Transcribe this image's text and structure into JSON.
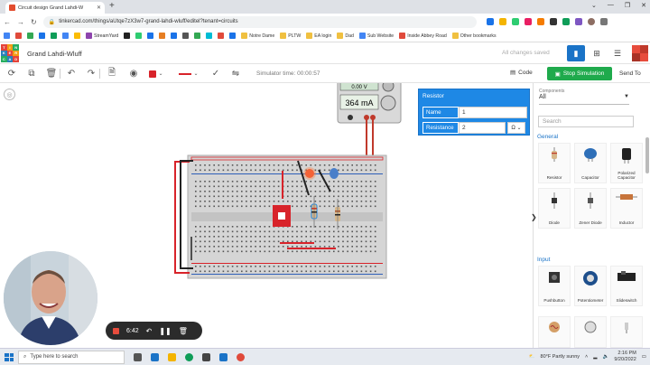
{
  "browser": {
    "tab_title": "Circuit design Grand Lahdi-W",
    "url": "tinkercad.com/things/aUtqe7zX3w7-grand-lahdi-wluff/editel?tenant=circuits",
    "bookmarks": [
      {
        "label": "",
        "color": "#4285f4"
      },
      {
        "label": "",
        "color": "#e04a3b"
      },
      {
        "label": "",
        "color": "#34a853"
      },
      {
        "label": "",
        "color": "#1a73e8"
      },
      {
        "label": "",
        "color": "#0f9d58"
      },
      {
        "label": "",
        "color": "#4285f4"
      },
      {
        "label": "",
        "color": "#fbbc05"
      },
      {
        "label": "StreamYard",
        "color": "#8e44ad"
      },
      {
        "label": "",
        "color": "#222222"
      },
      {
        "label": "",
        "color": "#2ecc71"
      },
      {
        "label": "",
        "color": "#1a73e8"
      },
      {
        "label": "",
        "color": "#e67e22"
      },
      {
        "label": "",
        "color": "#1a73e8"
      },
      {
        "label": "",
        "color": "#555555"
      },
      {
        "label": "",
        "color": "#34a853"
      },
      {
        "label": "",
        "color": "#00bcd4"
      },
      {
        "label": "",
        "color": "#e04a3b"
      },
      {
        "label": "",
        "color": "#1a73e8"
      },
      {
        "label": "Notre Dame",
        "color": "#f0c040"
      },
      {
        "label": "PLTW",
        "color": "#f0c040"
      },
      {
        "label": "EA login",
        "color": "#f0c040"
      },
      {
        "label": "Dad",
        "color": "#f0c040"
      },
      {
        "label": "Sub Website",
        "color": "#4285f4"
      },
      {
        "label": "Inside Abbey Road",
        "color": "#e04a3b"
      },
      {
        "label": "Other bookmarks",
        "color": "#f0c040"
      }
    ]
  },
  "header": {
    "design_title": "Grand Lahdi-Wluff",
    "saved_status": "All changes saved",
    "logo_letters": [
      "TIN",
      "KER",
      "CAD"
    ]
  },
  "toolbar": {
    "sim_time": "Simulator time: 00:00:57",
    "code_label": "Code",
    "stop_label": "Stop Simulation",
    "send_label": "Send To"
  },
  "multimeter": {
    "top_value": "0.00 V",
    "reading": "364 mA"
  },
  "inspector": {
    "title": "Resistor",
    "name_label": "Name",
    "name_value": "1",
    "resistance_label": "Resistance",
    "resistance_value": "2",
    "unit": "Ω"
  },
  "panel": {
    "dropdown_label": "Components",
    "dropdown_value": "All",
    "search_placeholder": "Search",
    "section_general": "General",
    "section_input": "Input",
    "general_items": [
      "Resistor",
      "Capacitor",
      "Polarized Capacitor",
      "Diode",
      "Zener Diode",
      "Inductor"
    ],
    "input_items": [
      "Pushbutton",
      "Potentiometer",
      "Slideswitch"
    ]
  },
  "recorder": {
    "time": "6:42"
  },
  "taskbar": {
    "search_placeholder": "Type here to search",
    "weather": "80°F  Partly sunny",
    "time": "2:16 PM",
    "date": "9/20/2022"
  },
  "colors": {
    "accent": "#1e88e5",
    "stop_green": "#1faa4c",
    "wire_red": "#d8232a"
  }
}
